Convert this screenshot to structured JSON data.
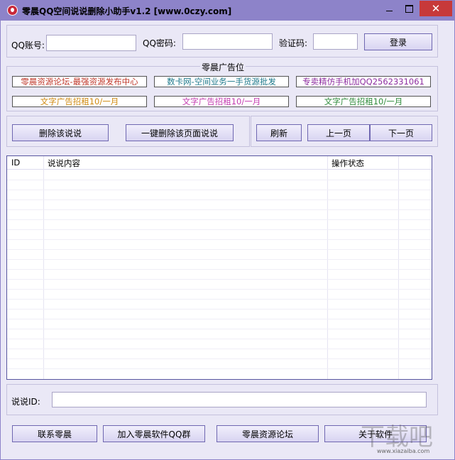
{
  "window": {
    "title": "零晨QQ空间说说删除小助手v1.2     [www.0czy.com]"
  },
  "login": {
    "qq_label": "QQ账号:",
    "pwd_label": "QQ密码:",
    "captcha_label": "验证码:",
    "qq_value": "",
    "pwd_value": "",
    "captcha_value": "",
    "login_button": "登录"
  },
  "ads": {
    "section_title": "零晨广告位",
    "items": [
      {
        "text": "零晨资源论坛-最强资源发布中心",
        "color": "#c0392b"
      },
      {
        "text": "数卡网-空间业务一手货源批发",
        "color": "#1f7a8c"
      },
      {
        "text": "专卖精仿手机加QQ2562331061",
        "color": "#8e2ea0"
      },
      {
        "text": "文字广告招租10/一月",
        "color": "#d08a10"
      },
      {
        "text": "文字广告招租10/一月",
        "color": "#c43bb0"
      },
      {
        "text": "文字广告招租10/一月",
        "color": "#2e8b3a"
      }
    ]
  },
  "actions": {
    "delete_button": "删除该说说",
    "delete_page_button": "一键删除该页面说说",
    "refresh_button": "刷新",
    "prev_button": "上一页",
    "next_button": "下一页"
  },
  "table": {
    "headers": [
      "ID",
      "说说内容",
      "操作状态"
    ],
    "rows": []
  },
  "bottom": {
    "id_label": "说说ID:",
    "id_value": "",
    "contact_button": "联系零晨",
    "join_group_button": "加入零晨软件QQ群",
    "forum_button": "零晨资源论坛",
    "about_button": "关于软件"
  },
  "watermark": {
    "text": "www.xiazaiba.com"
  }
}
